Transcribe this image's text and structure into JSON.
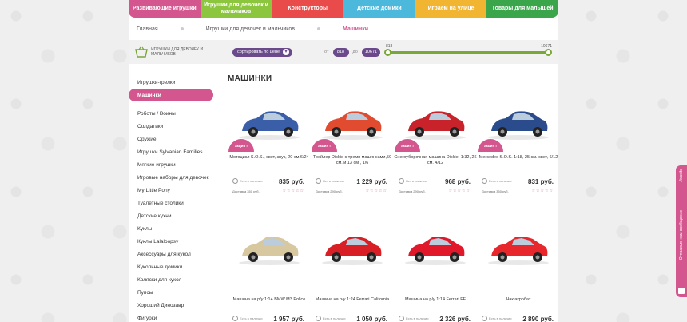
{
  "topnav": [
    {
      "label": "Развивающие игрушки",
      "color": "#d4568f"
    },
    {
      "label": "Игрушки для девочек и мальчиков",
      "color": "#8cc63e"
    },
    {
      "label": "Конструкторы",
      "color": "#e94b4b"
    },
    {
      "label": "Детские домики",
      "color": "#4bb8dc"
    },
    {
      "label": "Играем на улице",
      "color": "#f2b532"
    },
    {
      "label": "Товары для малышей",
      "color": "#3aa54a"
    }
  ],
  "breadcrumb": [
    "Главная",
    "Игрушки для девочек и мальчиков",
    "Машинки"
  ],
  "filter": {
    "category": "Игрушки для девочек и мальчиков",
    "sort_label": "сортировать по цене",
    "from_label": "от",
    "from_value": "818",
    "to_label": "до",
    "to_value": "10671",
    "slider_min": "818",
    "slider_max": "10671"
  },
  "sidebar": [
    "Игрушки-грелки",
    "Машинки",
    "Роботы / Воины",
    "Солдатики",
    "Оружие",
    "Игрушки Sylvanian Families",
    "Мягкие игрушки",
    "Игровые наборы для девочек",
    "My Little Pony",
    "Туалетные столики",
    "Детские кухни",
    "Куклы",
    "Куклы Lalaloopsy",
    "Аксессуары для кукол",
    "Кукольные домики",
    "Коляски для кукол",
    "Пупсы",
    "Хороший Динозавр",
    "Фигурки"
  ],
  "heading": "МАШИНКИ",
  "badge": "акция !",
  "stars": "☆☆☆☆☆",
  "products": [
    {
      "name": "Мотоцикл S.O.S., свет, звук, 20 см,6/24",
      "avail": "Есть в наличии",
      "price": "835 руб.",
      "delivery": "Доставка 350 руб.",
      "badge": true,
      "color": "#3a5fa8"
    },
    {
      "name": "Трейлер Dickie с тремя машинками,59 см. и 13 см., 1/6",
      "avail": "Нет в наличии",
      "price": "1 229 руб.",
      "delivery": "Доставка 290 руб.",
      "badge": true,
      "color": "#e14b2f"
    },
    {
      "name": "Снегоуборочная машина Dickie, 1:32, 26 см. 4/12",
      "avail": "Нет в наличии",
      "price": "968 руб.",
      "delivery": "Доставка 290 руб.",
      "badge": true,
      "color": "#c8232a"
    },
    {
      "name": "Mercedes S.O.S. 1:18, 25 см. свет, 6/12",
      "avail": "Есть в наличии",
      "price": "831 руб.",
      "delivery": "Доставка 350 руб.",
      "badge": true,
      "color": "#2b4c8c"
    },
    {
      "name": "Машина на р/у 1:14 BMW M3 Police",
      "avail": "Есть в наличии",
      "price": "1 957 руб.",
      "badge": false,
      "color": "#d8c8a0"
    },
    {
      "name": "Машина на р/у 1:24 Ferrari California",
      "avail": "Есть в наличии",
      "price": "1 050 руб.",
      "badge": false,
      "color": "#d81f26"
    },
    {
      "name": "Машина на р/у 1:14 Ferrari FF",
      "avail": "Есть в наличии",
      "price": "2 326 руб.",
      "badge": false,
      "color": "#e0182a"
    },
    {
      "name": "Чак акробат",
      "avail": "Есть в наличии",
      "price": "2 890 руб.",
      "badge": false,
      "color": "#e8272c"
    }
  ],
  "feedback": {
    "text": "Отправьте нам сообщение",
    "label": "Jivosite"
  }
}
